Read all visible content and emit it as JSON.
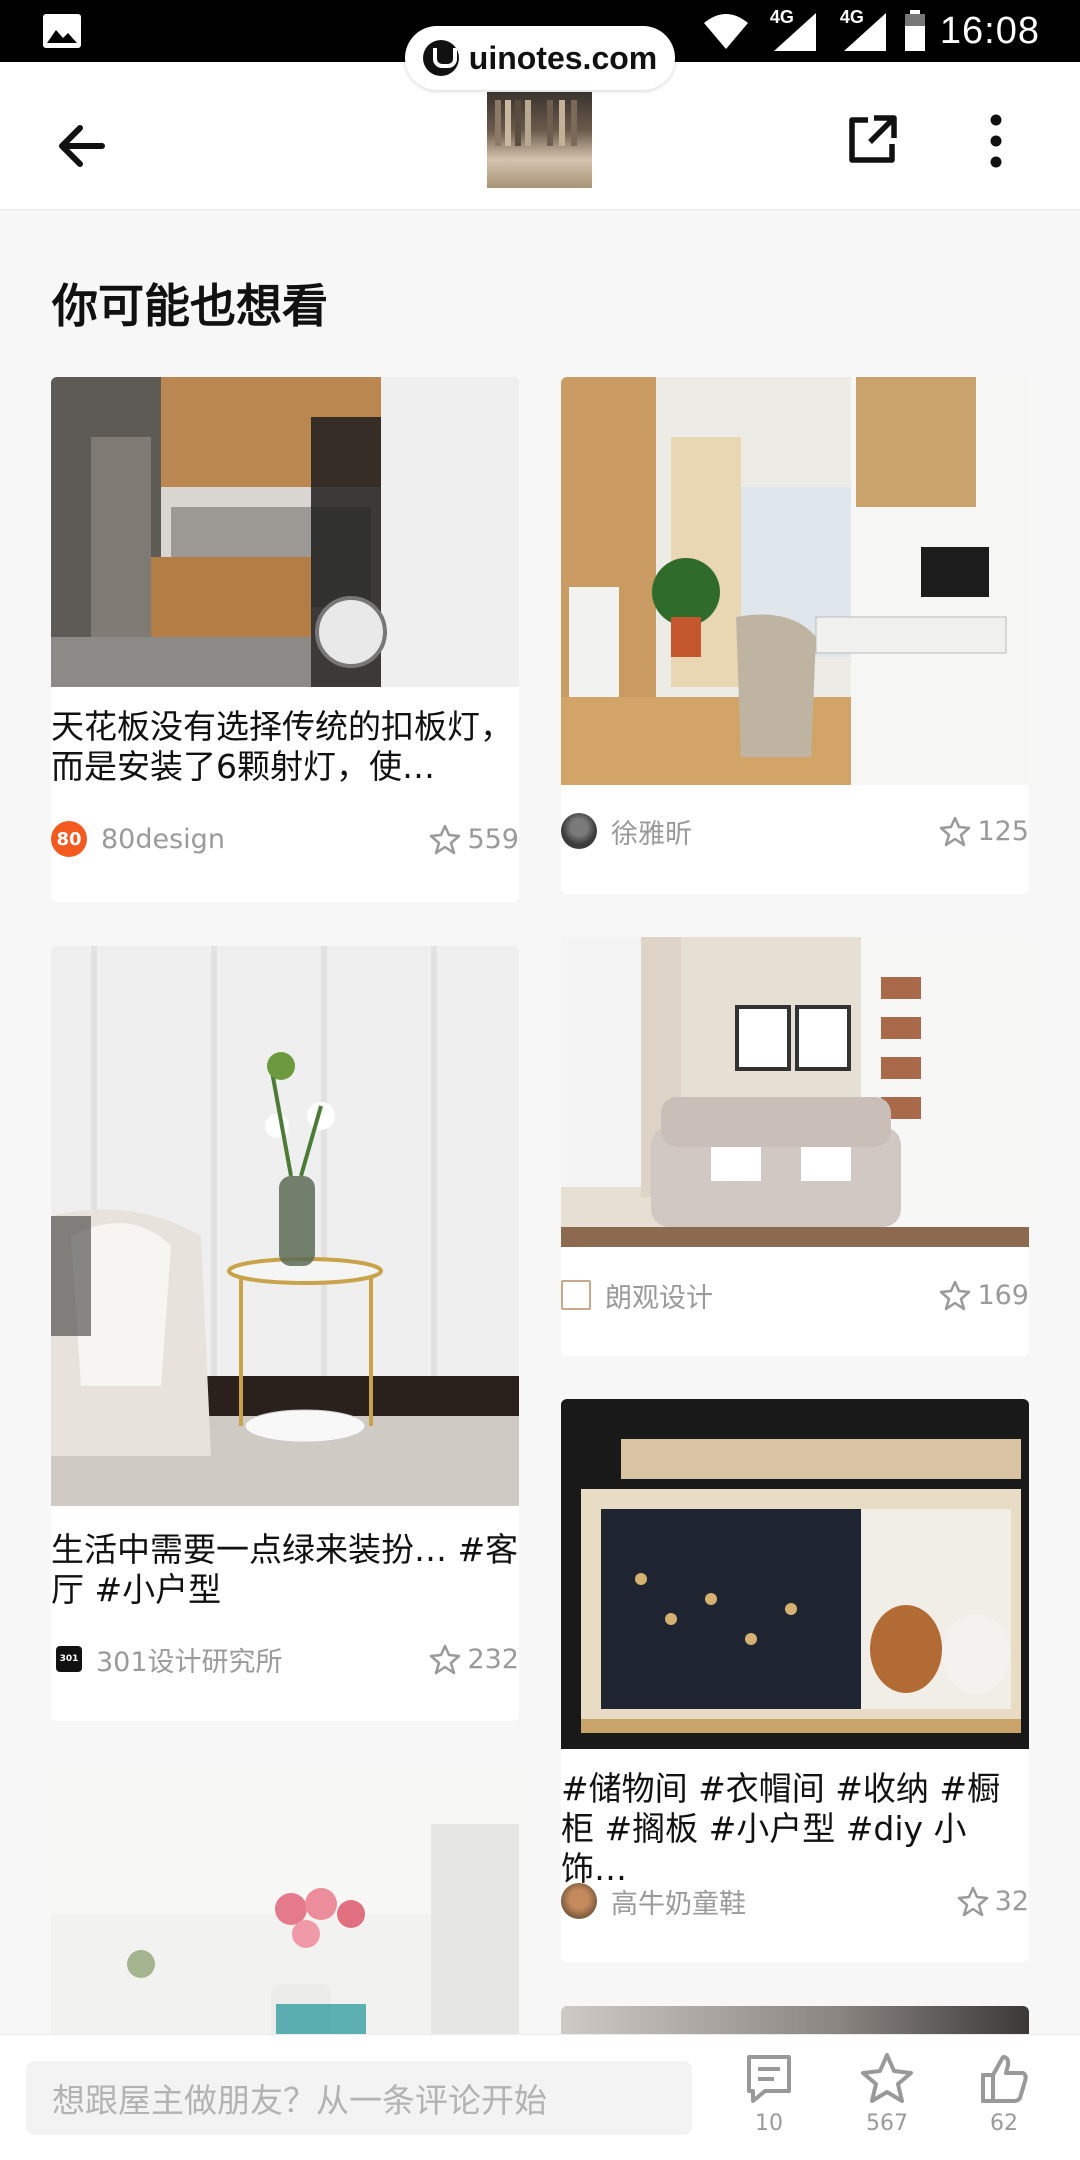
{
  "status_bar": {
    "time": "16:08",
    "net1": "4G",
    "net2": "4G"
  },
  "watermark": {
    "text": "uinotes.com"
  },
  "app_bar": {
    "back": "arrow-left-icon",
    "share": "share-icon",
    "more": "more-vertical-icon"
  },
  "section": {
    "title": "你可能也想看"
  },
  "cards": [
    {
      "title": "天花板没有选择传统的扣板灯，而是安装了6颗射灯，使…",
      "author": "80design",
      "avatar_text": "80",
      "likes": "559",
      "avatar_color": "#f25a1f"
    },
    {
      "title": "",
      "author": "徐雅昕",
      "likes": "125"
    },
    {
      "title": "生活中需要一点绿来装扮… #客厅 #小户型",
      "author": "301设计研究所",
      "avatar_text": "301",
      "likes": "232"
    },
    {
      "title": "",
      "author": "朗观设计",
      "likes": "169"
    },
    {
      "title": "#储物间 #衣帽间 #收纳 #橱柜 #搁板 #小户型 #diy 小饰…",
      "author": "高牛奶童鞋",
      "likes": "32"
    }
  ],
  "bottom_bar": {
    "comment_placeholder": "想跟屋主做朋友？从一条评论开始",
    "comments_count": "10",
    "favorites_count": "567",
    "likes_count": "62"
  },
  "colors": {
    "accent": "#f25a1f",
    "muted": "#9a9a9a"
  }
}
